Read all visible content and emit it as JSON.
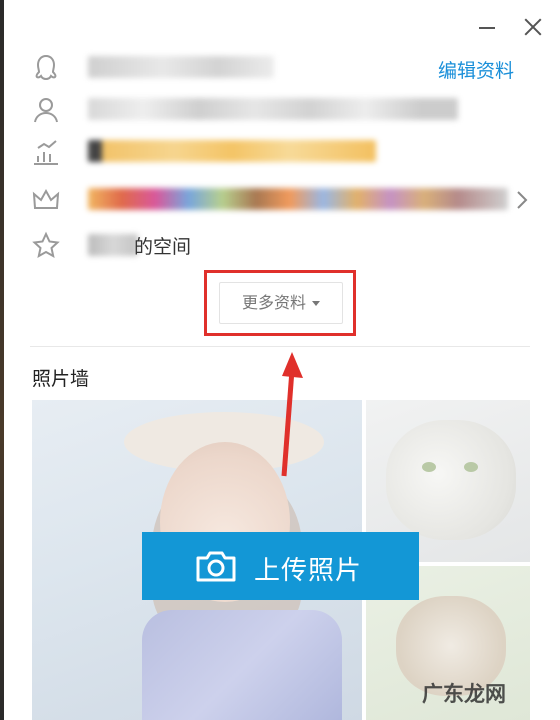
{
  "window": {
    "minimize_icon": "minimize-icon",
    "close_icon": "close-icon"
  },
  "header": {
    "edit_profile_label": "编辑资料"
  },
  "profile_rows": [
    {
      "icon": "qq-penguin-icon",
      "text": ""
    },
    {
      "icon": "user-icon",
      "text": ""
    },
    {
      "icon": "level-chart-icon",
      "text": ""
    },
    {
      "icon": "crown-icon",
      "text": ""
    },
    {
      "icon": "star-icon",
      "text": "的空间"
    }
  ],
  "more_info": {
    "label": "更多资料"
  },
  "photo_wall": {
    "title": "照片墙",
    "upload_label": "上传照片"
  },
  "watermark": {
    "text": "广东龙网"
  },
  "colors": {
    "accent": "#1397d6",
    "link": "#1a8fd9",
    "highlight": "#e0302b"
  }
}
